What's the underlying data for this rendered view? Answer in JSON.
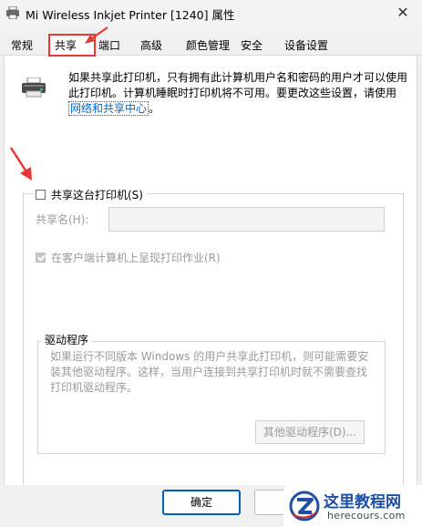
{
  "window": {
    "title": "Mi Wireless Inkjet Printer [1240] 属性",
    "close_glyph": "✕"
  },
  "tabs": [
    {
      "label": "常规"
    },
    {
      "label": "共享"
    },
    {
      "label": "端口"
    },
    {
      "label": "高级"
    },
    {
      "label": "颜色管理"
    },
    {
      "label": "安全"
    },
    {
      "label": "设备设置"
    }
  ],
  "active_tab": "共享",
  "sharing": {
    "description_main": "如果共享此打印机，只有拥有此计算机用户名和密码的用户才可以使用此打印机。计算机睡眠时打印机将不可用。要更改这些设置，请使用",
    "network_link": "网络和共享中心",
    "description_end": "。",
    "share_checkbox_label": "共享这台打印机(S)",
    "share_checked": false,
    "share_name_label": "共享名(H):",
    "share_name_value": "",
    "render_checkbox_label": "在客户端计算机上呈现打印作业(R)",
    "render_checked": true
  },
  "drivers": {
    "title": "驱动程序",
    "description": "如果运行不同版本 Windows 的用户共享此打印机，则可能需要安装其他驱动程序。这样，当用户连接到共享打印机时就不需要查找打印机驱动程序。",
    "button_label": "其他驱动程序(D)..."
  },
  "buttons": {
    "ok": "确定",
    "cancel": "取"
  },
  "watermark": {
    "title": "这里教程网",
    "url": "herecours.com"
  },
  "colors": {
    "accent": "#005fb8",
    "annotation": "#e53935",
    "link": "#0066cc",
    "disabled_text": "#9a9a9a"
  }
}
